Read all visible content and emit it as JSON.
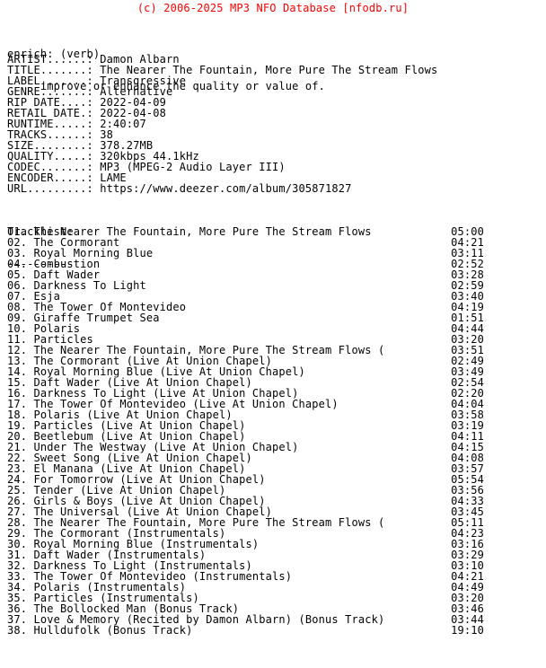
{
  "banner": {
    "text": "(c) 2006-2025 MP3 NFO Database [nfodb.ru]",
    "color": "#ff0000"
  },
  "definition": {
    "term_line": "enrich: (verb)",
    "meaning_line": "     improve or enhance the quality or value of."
  },
  "metadata": {
    "label_width": 12,
    "fields": [
      {
        "label": "ARTIST",
        "value": "Damon Albarn"
      },
      {
        "label": "TITLE",
        "value": "The Nearer The Fountain, More Pure The Stream Flows"
      },
      {
        "label": "LABEL",
        "value": "Transgressive"
      },
      {
        "label": "GENRE",
        "value": "Alternative"
      },
      {
        "label": "RIP DATE",
        "value": "2022-04-09"
      },
      {
        "label": "RETAIL DATE",
        "value": "2022-04-08"
      },
      {
        "label": "RUNTIME",
        "value": "2:40:07"
      },
      {
        "label": "TRACKS",
        "value": "38"
      },
      {
        "label": "SIZE",
        "value": "378.27MB"
      },
      {
        "label": "QUALITY",
        "value": "320kbps 44.1kHz"
      },
      {
        "label": "CODEC",
        "value": "MP3 (MPEG-2 Audio Layer III)"
      },
      {
        "label": "ENCODER",
        "value": "LAME"
      },
      {
        "label": "URL",
        "value": "https://www.deezer.com/album/305871827"
      }
    ]
  },
  "tracklist": {
    "heading": "Tracklist:",
    "underline": "----------",
    "time_column": 67,
    "tracks": [
      {
        "num": "01",
        "title": "The Nearer The Fountain, More Pure The Stream Flows",
        "time": "05:00"
      },
      {
        "num": "02",
        "title": "The Cormorant",
        "time": "04:21"
      },
      {
        "num": "03",
        "title": "Royal Morning Blue",
        "time": "03:11"
      },
      {
        "num": "04",
        "title": "Combustion",
        "time": "02:52"
      },
      {
        "num": "05",
        "title": "Daft Wader",
        "time": "03:28"
      },
      {
        "num": "06",
        "title": "Darkness To Light",
        "time": "02:59"
      },
      {
        "num": "07",
        "title": "Esja",
        "time": "03:40"
      },
      {
        "num": "08",
        "title": "The Tower Of Montevideo",
        "time": "04:19"
      },
      {
        "num": "09",
        "title": "Giraffe Trumpet Sea",
        "time": "01:51"
      },
      {
        "num": "10",
        "title": "Polaris",
        "time": "04:44"
      },
      {
        "num": "11",
        "title": "Particles",
        "time": "03:20"
      },
      {
        "num": "12",
        "title": "The Nearer The Fountain, More Pure The Stream Flows (",
        "time": "03:51"
      },
      {
        "num": "13",
        "title": "The Cormorant (Live At Union Chapel)",
        "time": "02:49"
      },
      {
        "num": "14",
        "title": "Royal Morning Blue (Live At Union Chapel)",
        "time": "03:49"
      },
      {
        "num": "15",
        "title": "Daft Wader (Live At Union Chapel)",
        "time": "02:54"
      },
      {
        "num": "16",
        "title": "Darkness To Light (Live At Union Chapel)",
        "time": "02:20"
      },
      {
        "num": "17",
        "title": "The Tower Of Montevideo (Live At Union Chapel)",
        "time": "04:04"
      },
      {
        "num": "18",
        "title": "Polaris (Live At Union Chapel)",
        "time": "03:58"
      },
      {
        "num": "19",
        "title": "Particles (Live At Union Chapel)",
        "time": "03:19"
      },
      {
        "num": "20",
        "title": "Beetlebum (Live At Union Chapel)",
        "time": "04:11"
      },
      {
        "num": "21",
        "title": "Under The Westway (Live At Union Chapel)",
        "time": "04:15"
      },
      {
        "num": "22",
        "title": "Sweet Song (Live At Union Chapel)",
        "time": "04:08"
      },
      {
        "num": "23",
        "title": "El Manana (Live At Union Chapel)",
        "time": "03:57"
      },
      {
        "num": "24",
        "title": "For Tomorrow (Live At Union Chapel)",
        "time": "05:54"
      },
      {
        "num": "25",
        "title": "Tender (Live At Union Chapel)",
        "time": "03:56"
      },
      {
        "num": "26",
        "title": "Girls & Boys (Live At Union Chapel)",
        "time": "04:33"
      },
      {
        "num": "27",
        "title": "The Universal (Live At Union Chapel)",
        "time": "03:45"
      },
      {
        "num": "28",
        "title": "The Nearer The Fountain, More Pure The Stream Flows (",
        "time": "05:11"
      },
      {
        "num": "29",
        "title": "The Cormorant (Instrumentals)",
        "time": "04:23"
      },
      {
        "num": "30",
        "title": "Royal Morning Blue (Instrumentals)",
        "time": "03:16"
      },
      {
        "num": "31",
        "title": "Daft Wader (Instrumentals)",
        "time": "03:29"
      },
      {
        "num": "32",
        "title": "Darkness To Light (Instrumentals)",
        "time": "03:10"
      },
      {
        "num": "33",
        "title": "The Tower Of Montevideo (Instrumentals)",
        "time": "04:21"
      },
      {
        "num": "34",
        "title": "Polaris (Instrumentals)",
        "time": "04:49"
      },
      {
        "num": "35",
        "title": "Particles (Instrumentals)",
        "time": "03:20"
      },
      {
        "num": "36",
        "title": "The Bollocked Man (Bonus Track)",
        "time": "03:46"
      },
      {
        "num": "37",
        "title": "Love & Memory (Recited by Damon Albarn) (Bonus Track)",
        "time": "03:44"
      },
      {
        "num": "38",
        "title": "Hulldufolk (Bonus Track)",
        "time": "19:10"
      }
    ]
  }
}
